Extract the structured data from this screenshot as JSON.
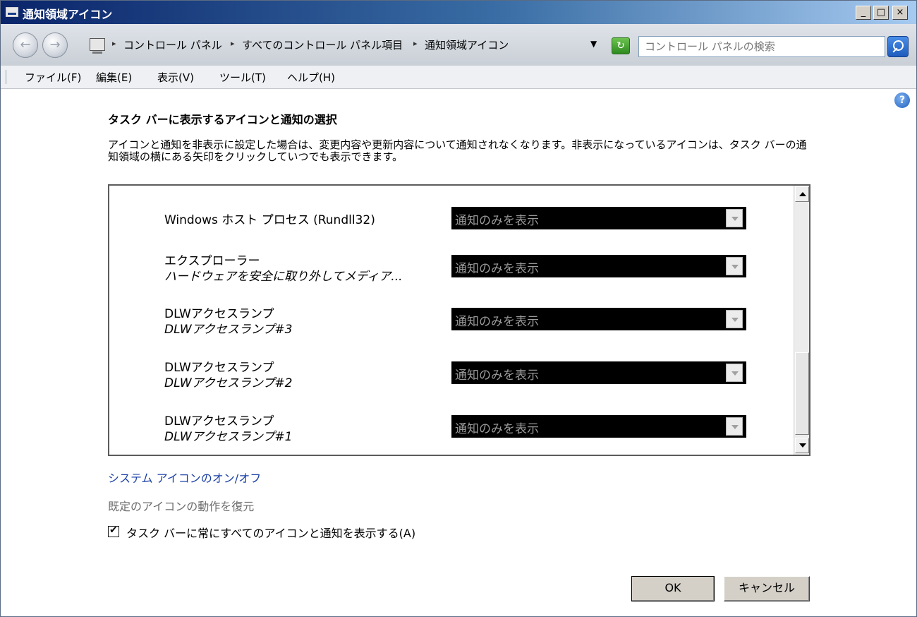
{
  "window": {
    "title": "通知領域アイコン",
    "minimize_label": "_",
    "maximize_label": "□",
    "close_label": "×"
  },
  "address_bar": {
    "back_label": "←",
    "forward_label": "→",
    "breadcrumbs": [
      "コントロール パネル",
      "すべてのコントロール パネル項目",
      "通知領域アイコン"
    ],
    "separator": "▸",
    "dropdown_label": "▼",
    "refresh_label": "↻",
    "search_placeholder": "コントロール パネルの検索"
  },
  "menu": {
    "items": [
      "ファイル(F)",
      "編集(E)",
      "表示(V)",
      "ツール(T)",
      "ヘルプ(H)"
    ]
  },
  "content": {
    "help_label": "?",
    "heading": "タスク バーに表示するアイコンと通知の選択",
    "description": "アイコンと通知を非表示に設定した場合は、変更内容や更新内容について通知されなくなります。非表示になっているアイコンは、タスク バーの通知領域の横にある矢印をクリックしていつでも表示できます。",
    "rows": [
      {
        "name": "Windows ホスト プロセス (Rundll32)",
        "sub": "",
        "behavior": "通知のみを表示"
      },
      {
        "name": "エクスプローラー",
        "sub": "ハードウェアを安全に取り外してメディア...",
        "behavior": "通知のみを表示"
      },
      {
        "name": "DLWアクセスランプ",
        "sub": "DLWアクセスランプ#3",
        "behavior": "通知のみを表示"
      },
      {
        "name": "DLWアクセスランプ",
        "sub": "DLWアクセスランプ#2",
        "behavior": "通知のみを表示"
      },
      {
        "name": "DLWアクセスランプ",
        "sub": "DLWアクセスランプ#1",
        "behavior": "通知のみを表示"
      }
    ],
    "system_icons_link": "システム アイコンのオン/オフ",
    "restore_default": "既定のアイコンの動作を復元",
    "always_show_checkbox": {
      "label": "タスク バーに常にすべてのアイコンと通知を表示する(A)",
      "checked": true
    }
  },
  "buttons": {
    "ok": "OK",
    "cancel": "キャンセル"
  }
}
